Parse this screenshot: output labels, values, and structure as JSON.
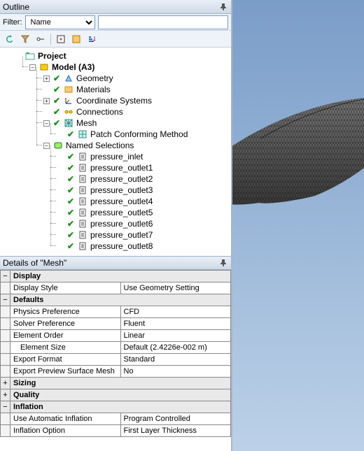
{
  "outline": {
    "title": "Outline",
    "filter_label": "Filter:",
    "filter_type": "Name",
    "filter_value": "",
    "root": "Project",
    "model": "Model (A3)",
    "branches": {
      "geometry": "Geometry",
      "materials": "Materials",
      "coord": "Coordinate Systems",
      "connections": "Connections",
      "mesh": "Mesh",
      "mesh_child": "Patch Conforming Method",
      "named": "Named Selections"
    },
    "selections": [
      "pressure_inlet",
      "pressure_outlet1",
      "pressure_outlet2",
      "pressure_outlet3",
      "pressure_outlet4",
      "pressure_outlet5",
      "pressure_outlet6",
      "pressure_outlet7",
      "pressure_outlet8"
    ]
  },
  "details": {
    "title": "Details of \"Mesh\"",
    "groups": {
      "display": "Display",
      "defaults": "Defaults",
      "sizing": "Sizing",
      "quality": "Quality",
      "inflation": "Inflation"
    },
    "rows": {
      "display_style_k": "Display Style",
      "display_style_v": "Use Geometry Setting",
      "physics_k": "Physics Preference",
      "physics_v": "CFD",
      "solver_k": "Solver Preference",
      "solver_v": "Fluent",
      "order_k": "Element Order",
      "order_v": "Linear",
      "size_k": "Element Size",
      "size_v": "Default (2.4226e-002 m)",
      "export_k": "Export Format",
      "export_v": "Standard",
      "preview_k": "Export Preview Surface Mesh",
      "preview_v": "No",
      "auto_infl_k": "Use Automatic Inflation",
      "auto_infl_v": "Program Controlled",
      "infl_opt_k": "Inflation Option",
      "infl_opt_v": "First Layer Thickness"
    }
  }
}
